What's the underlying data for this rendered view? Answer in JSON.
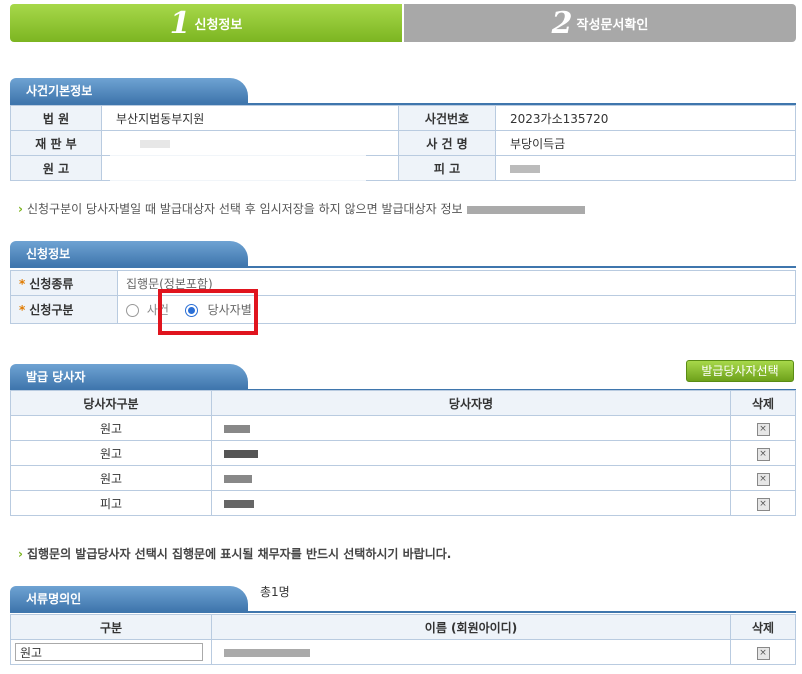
{
  "steps": [
    {
      "num": "1",
      "label": "신청정보"
    },
    {
      "num": "2",
      "label": "작성문서확인"
    }
  ],
  "case_info": {
    "title": "사건기본정보",
    "court_label": "법 원",
    "court_value": "부산지법동부지원",
    "case_no_label": "사건번호",
    "case_no_value": "2023가소135720",
    "division_label": "재 판 부",
    "case_name_label": "사 건 명",
    "case_name_value": "부당이득금",
    "plaintiff_label": "원 고",
    "defendant_label": "피 고"
  },
  "notice1": "신청구분이 당사자별일 때 발급대상자 선택 후 임시저장을 하지 않으면 발급대상자 정보",
  "application": {
    "title": "신청정보",
    "type_label": "신청종류",
    "type_value": "집행문(정본포함)",
    "kind_label": "신청구분",
    "option_case": "사건",
    "option_party": "당사자별"
  },
  "issue_party": {
    "title": "발급 당사자",
    "select_button": "발급당사자선택",
    "col_type": "당사자구분",
    "col_name": "당사자명",
    "col_delete": "삭제",
    "rows": [
      {
        "type": "원고"
      },
      {
        "type": "원고"
      },
      {
        "type": "원고"
      },
      {
        "type": "피고"
      }
    ]
  },
  "notice2": "집행문의 발급당사자 선택시 집행문에 표시될 채무자를 반드시 선택하시기 바랍니다.",
  "doc_nominee": {
    "title": "서류명의인",
    "count": "총1명",
    "col_type": "구분",
    "col_name": "이름 (회원아이디)",
    "col_delete": "삭제",
    "rows": [
      {
        "type": "원고"
      }
    ]
  },
  "colors": {
    "accent_green": "#7cb521",
    "header_blue": "#3f76ad",
    "highlight_red": "#e0141e"
  }
}
